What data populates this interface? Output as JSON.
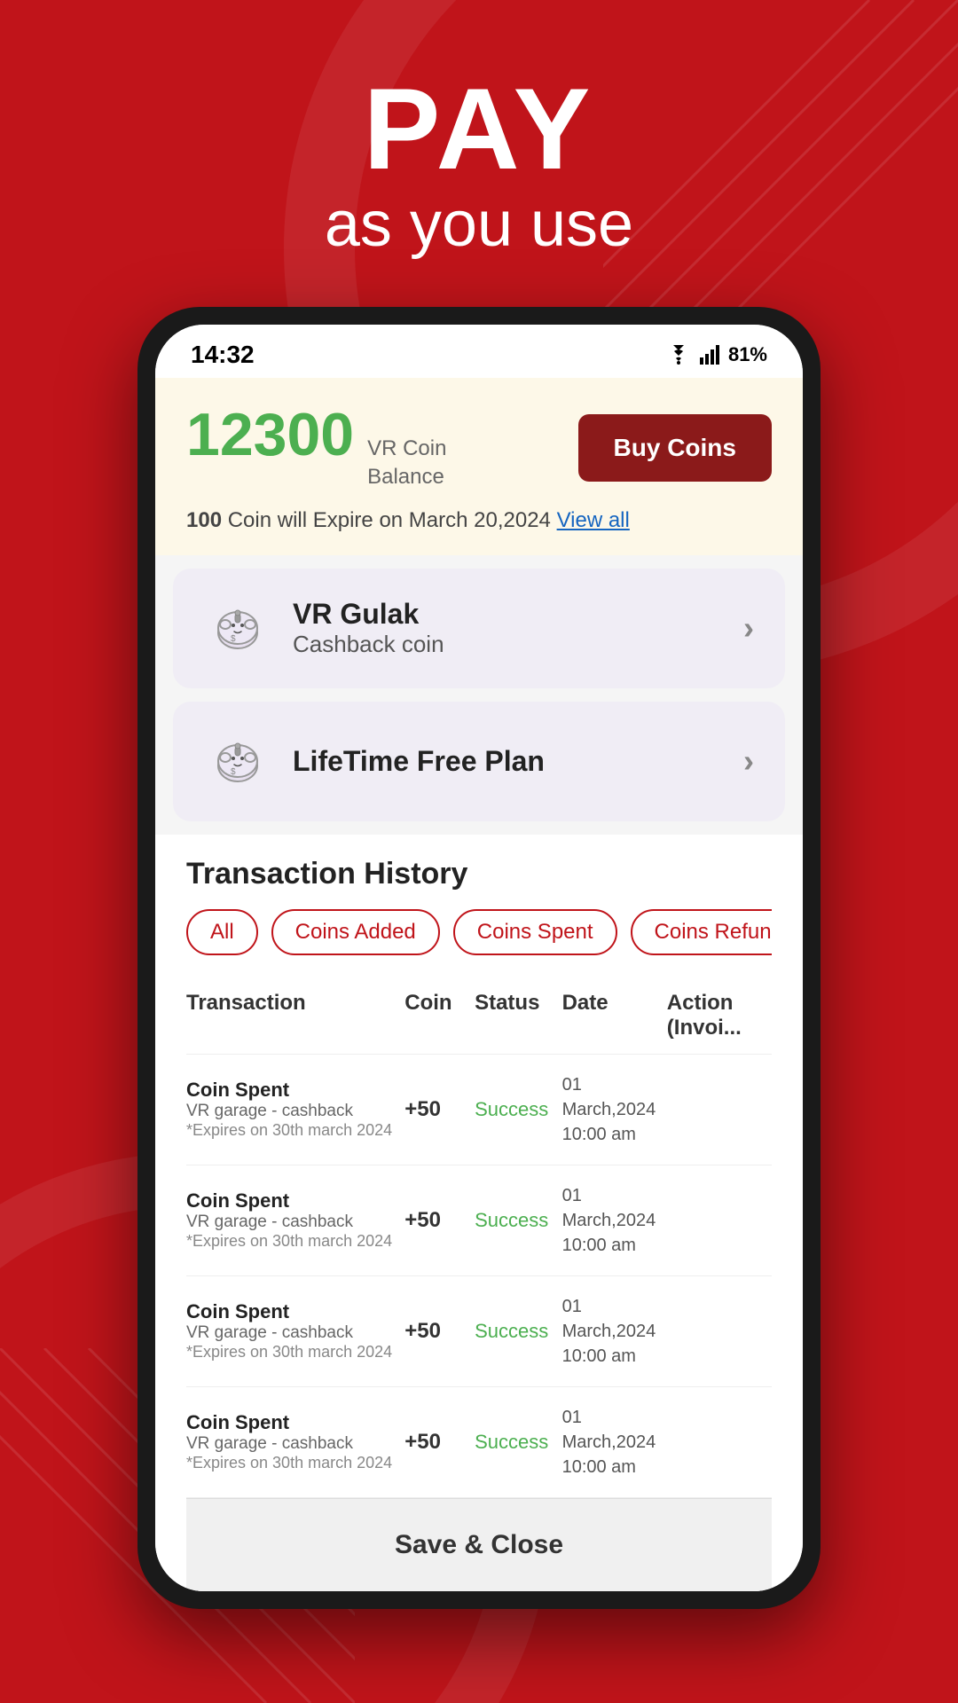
{
  "background": {
    "color": "#c0141a"
  },
  "header": {
    "pay_label": "PAY",
    "sub_label": "as you use"
  },
  "status_bar": {
    "time": "14:32",
    "battery": "81%"
  },
  "coin_balance": {
    "amount": "12300",
    "label_line1": "VR Coin",
    "label_line2": "Balance",
    "buy_button": "Buy Coins",
    "expiry_text_prefix": "100",
    "expiry_text": " Coin will Expire on March 20,2024 ",
    "view_all": "View all"
  },
  "vr_gulak": {
    "title": "VR Gulak",
    "subtitle": "Cashback coin",
    "icon": "🐷"
  },
  "lifetime_plan": {
    "title_part1": "LifeTime ",
    "title_bold": "Free",
    "title_part2": " Plan",
    "icon": "🐷"
  },
  "transaction_history": {
    "title": "Transaction History",
    "filters": [
      {
        "label": "All",
        "active": true
      },
      {
        "label": "Coins Added",
        "active": false
      },
      {
        "label": "Coins Spent",
        "active": false
      },
      {
        "label": "Coins Refunde...",
        "active": false
      }
    ],
    "columns": [
      "Transaction",
      "Coin",
      "Status",
      "Date",
      "Action (Invoi..."
    ],
    "rows": [
      {
        "name": "Coin Spent",
        "sub": "VR garage - cashback",
        "expire": "*Expires on 30th march 2024",
        "coin": "+50",
        "status": "Success",
        "date": "01 March,2024\n10:00 am"
      },
      {
        "name": "Coin Spent",
        "sub": "VR garage - cashback",
        "expire": "*Expires on 30th march 2024",
        "coin": "+50",
        "status": "Success",
        "date": "01 March,2024\n10:00 am"
      },
      {
        "name": "Coin Spent",
        "sub": "VR garage - cashback",
        "expire": "*Expires on 30th march 2024",
        "coin": "+50",
        "status": "Success",
        "date": "01 March,2024\n10:00 am"
      },
      {
        "name": "Coin Spent",
        "sub": "VR garage - cashback",
        "expire": "*Expires on 30th march 2024",
        "coin": "+50",
        "status": "Success",
        "date": "01 March,2024\n10:00 am"
      }
    ]
  },
  "save_close_btn": "Save & Close"
}
